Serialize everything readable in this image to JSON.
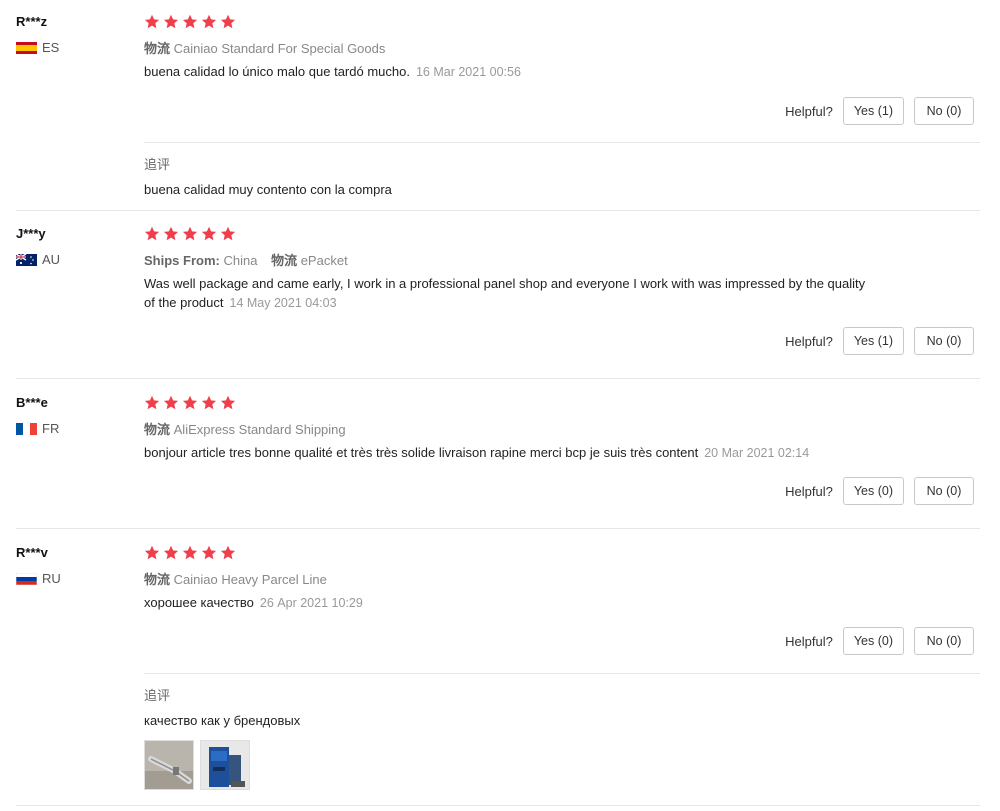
{
  "helpful_label": "Helpful?",
  "additional_feedback_label": "追评",
  "star_color": "#f03e4a",
  "reviews": [
    {
      "user": "R***z",
      "country": "ES",
      "stars": 5,
      "logistics_label": "物流",
      "logistics": "Cainiao Standard For Special Goods",
      "comment": "buena calidad lo único malo que tardó mucho.",
      "date": "16 Mar 2021 00:56",
      "yes": "Yes (1)",
      "no": "No (0)",
      "additional": "buena calidad muy contento con la compra"
    },
    {
      "user": "J***y",
      "country": "AU",
      "stars": 5,
      "ships_from_label": "Ships From:",
      "ships_from": "China",
      "logistics_label": "物流",
      "logistics": "ePacket",
      "comment": "Was well package and came early, I work in a professional panel shop and everyone I work with was impressed by the quality of the product",
      "date": "14 May 2021 04:03",
      "yes": "Yes (1)",
      "no": "No (0)"
    },
    {
      "user": "B***e",
      "country": "FR",
      "stars": 5,
      "logistics_label": "物流",
      "logistics": "AliExpress Standard Shipping",
      "comment": "bonjour article tres bonne qualité et très très solide livraison rapine merci bcp je suis très content",
      "date": "20 Mar 2021 02:14",
      "yes": "Yes (0)",
      "no": "No (0)"
    },
    {
      "user": "R***v",
      "country": "RU",
      "stars": 5,
      "logistics_label": "物流",
      "logistics": "Cainiao Heavy Parcel Line",
      "comment": "хорошее качество",
      "date": "26 Apr 2021 10:29",
      "yes": "Yes (0)",
      "no": "No (0)",
      "additional": "качество как у брендовых",
      "photos": [
        "photo-pipe",
        "photo-blue-machine"
      ]
    }
  ]
}
